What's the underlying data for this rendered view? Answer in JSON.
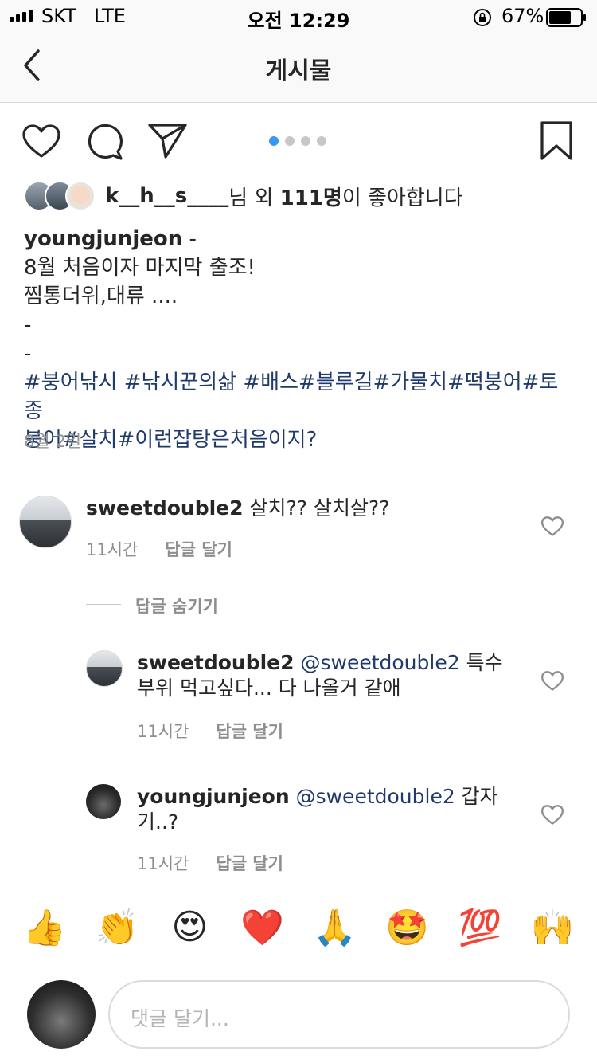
{
  "status_bar": {
    "carrier": "SKT",
    "network": "LTE",
    "time": "오전 12:29",
    "battery": "67%"
  },
  "nav": {
    "title": "게시물"
  },
  "carousel": {
    "count": 4,
    "active": 1
  },
  "likes": {
    "user": "k__h__s____",
    "mid": "님 외 ",
    "count": "111명",
    "suffix": "이 좋아합니다"
  },
  "caption": {
    "user": "youngjunjeon",
    "sep": " -",
    "line1": "8월 처음이자 마지막 출조!",
    "line2": "찜통더위,대류 ....",
    "line3": "-",
    "line4": "-",
    "tags_line1": "#붕어낚시 #낚시꾼의삶 #배스#블루길#가물치#떡붕어#토종",
    "tags_line2": "붕어#살치#이런잡탕은처음이지?"
  },
  "date": "8월 2일",
  "comments": [
    {
      "user": "sweetdouble2",
      "mention": "",
      "text": " 살치?? 살치살??",
      "time": "11시간",
      "reply": "답글 달기"
    }
  ],
  "hide_replies": "답글 숨기기",
  "replies": [
    {
      "user": "sweetdouble2",
      "mention": " @sweetdouble2",
      "text1": " 특수",
      "text2": "부위 먹고싶다... 다 나올거 같애",
      "time": "11시간",
      "reply": "답글 달기"
    },
    {
      "user": "youngjunjeon",
      "mention": " @sweetdouble2",
      "text1": " 갑자",
      "text2": "기..?",
      "time": "11시간",
      "reply": "답글 달기"
    }
  ],
  "emojis": [
    "👍",
    "👏",
    "😍",
    "❤️",
    "🙏",
    "🤩",
    "💯",
    "🙌"
  ],
  "comment_input": {
    "placeholder": "댓글 달기..."
  },
  "colors": {
    "accent": "#3897f0",
    "tag": "#1f3a6b",
    "muted": "#8e8e8e"
  }
}
